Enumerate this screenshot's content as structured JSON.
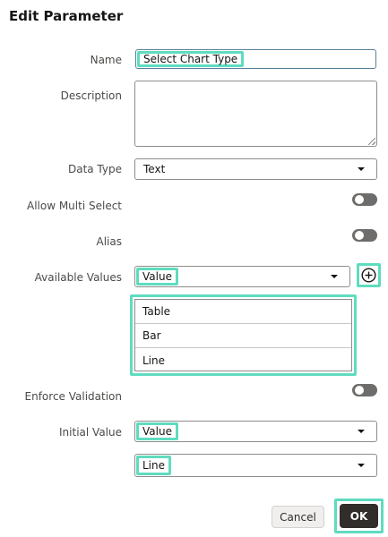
{
  "dialog": {
    "title": "Edit Parameter"
  },
  "form": {
    "name": {
      "label": "Name",
      "value": "Select Chart Type"
    },
    "description": {
      "label": "Description",
      "value": ""
    },
    "data_type": {
      "label": "Data Type",
      "value": "Text"
    },
    "allow_multi_select": {
      "label": "Allow Multi Select",
      "on": false
    },
    "alias": {
      "label": "Alias",
      "on": false
    },
    "available_values": {
      "label": "Available Values",
      "value": "Value",
      "items": [
        "Table",
        "Bar",
        "Line"
      ]
    },
    "enforce_validation": {
      "label": "Enforce Validation",
      "on": false
    },
    "initial_value": {
      "label": "Initial Value",
      "type_value": "Value",
      "value": "Line"
    }
  },
  "footer": {
    "cancel_label": "Cancel",
    "ok_label": "OK"
  },
  "colors": {
    "highlight": "#5fdcbf",
    "primary_button": "#312d2a",
    "toggle_off": "#6f6d6b"
  },
  "icons": {
    "add": "plus-circle-icon",
    "dropdown": "chevron-down-icon"
  }
}
